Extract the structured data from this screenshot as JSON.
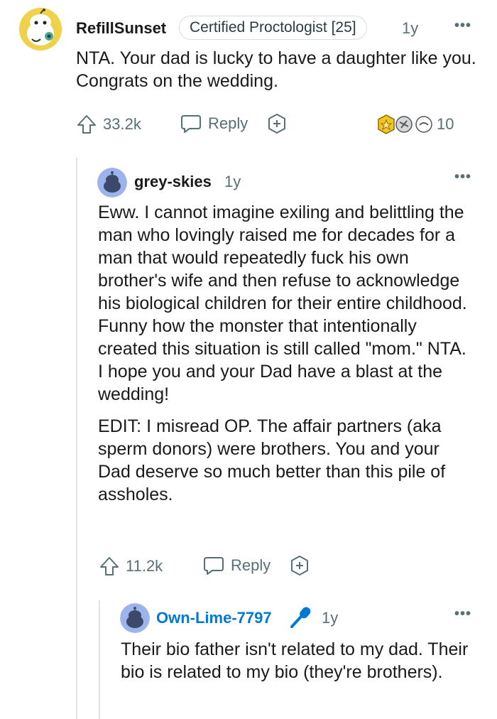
{
  "comments": [
    {
      "username": "RefillSunset",
      "flair": "Certified Proctologist [25]",
      "age": "1y",
      "body": [
        "NTA. Your dad is lucky to have a daughter like you. Congrats on the wedding."
      ],
      "votes": "33.2k",
      "reply_label": "Reply",
      "award_count": "10"
    },
    {
      "username": "grey-skies",
      "age": "1y",
      "body": [
        "Eww. I cannot imagine exiling and belittling the man who lovingly raised me for decades for a man that would repeatedly fuck his own brother's wife and then refuse to acknowledge his biological children for their entire childhood. Funny how the monster that intentionally created this situation is still called \"mom.\" NTA. I hope you and your Dad have a blast at the wedding!",
        "EDIT: I misread OP. The affair partners (aka sperm donors) were brothers. You and your Dad deserve so much better than this pile of assholes."
      ],
      "votes": "11.2k",
      "reply_label": "Reply"
    },
    {
      "username": "Own-Lime-7797",
      "age": "1y",
      "body": [
        "Their bio father isn't related to my dad. Their bio is related to my bio (they're brothers)."
      ],
      "op_color": "#0079d3"
    }
  ],
  "icons": {
    "upvote": "upvote-arrow-icon",
    "reply": "speech-bubble-icon",
    "award": "award-plus-icon",
    "more": "more-options-icon",
    "op": "microphone-icon"
  },
  "colors": {
    "muted": "#576f76",
    "op_blue": "#0079d3"
  }
}
